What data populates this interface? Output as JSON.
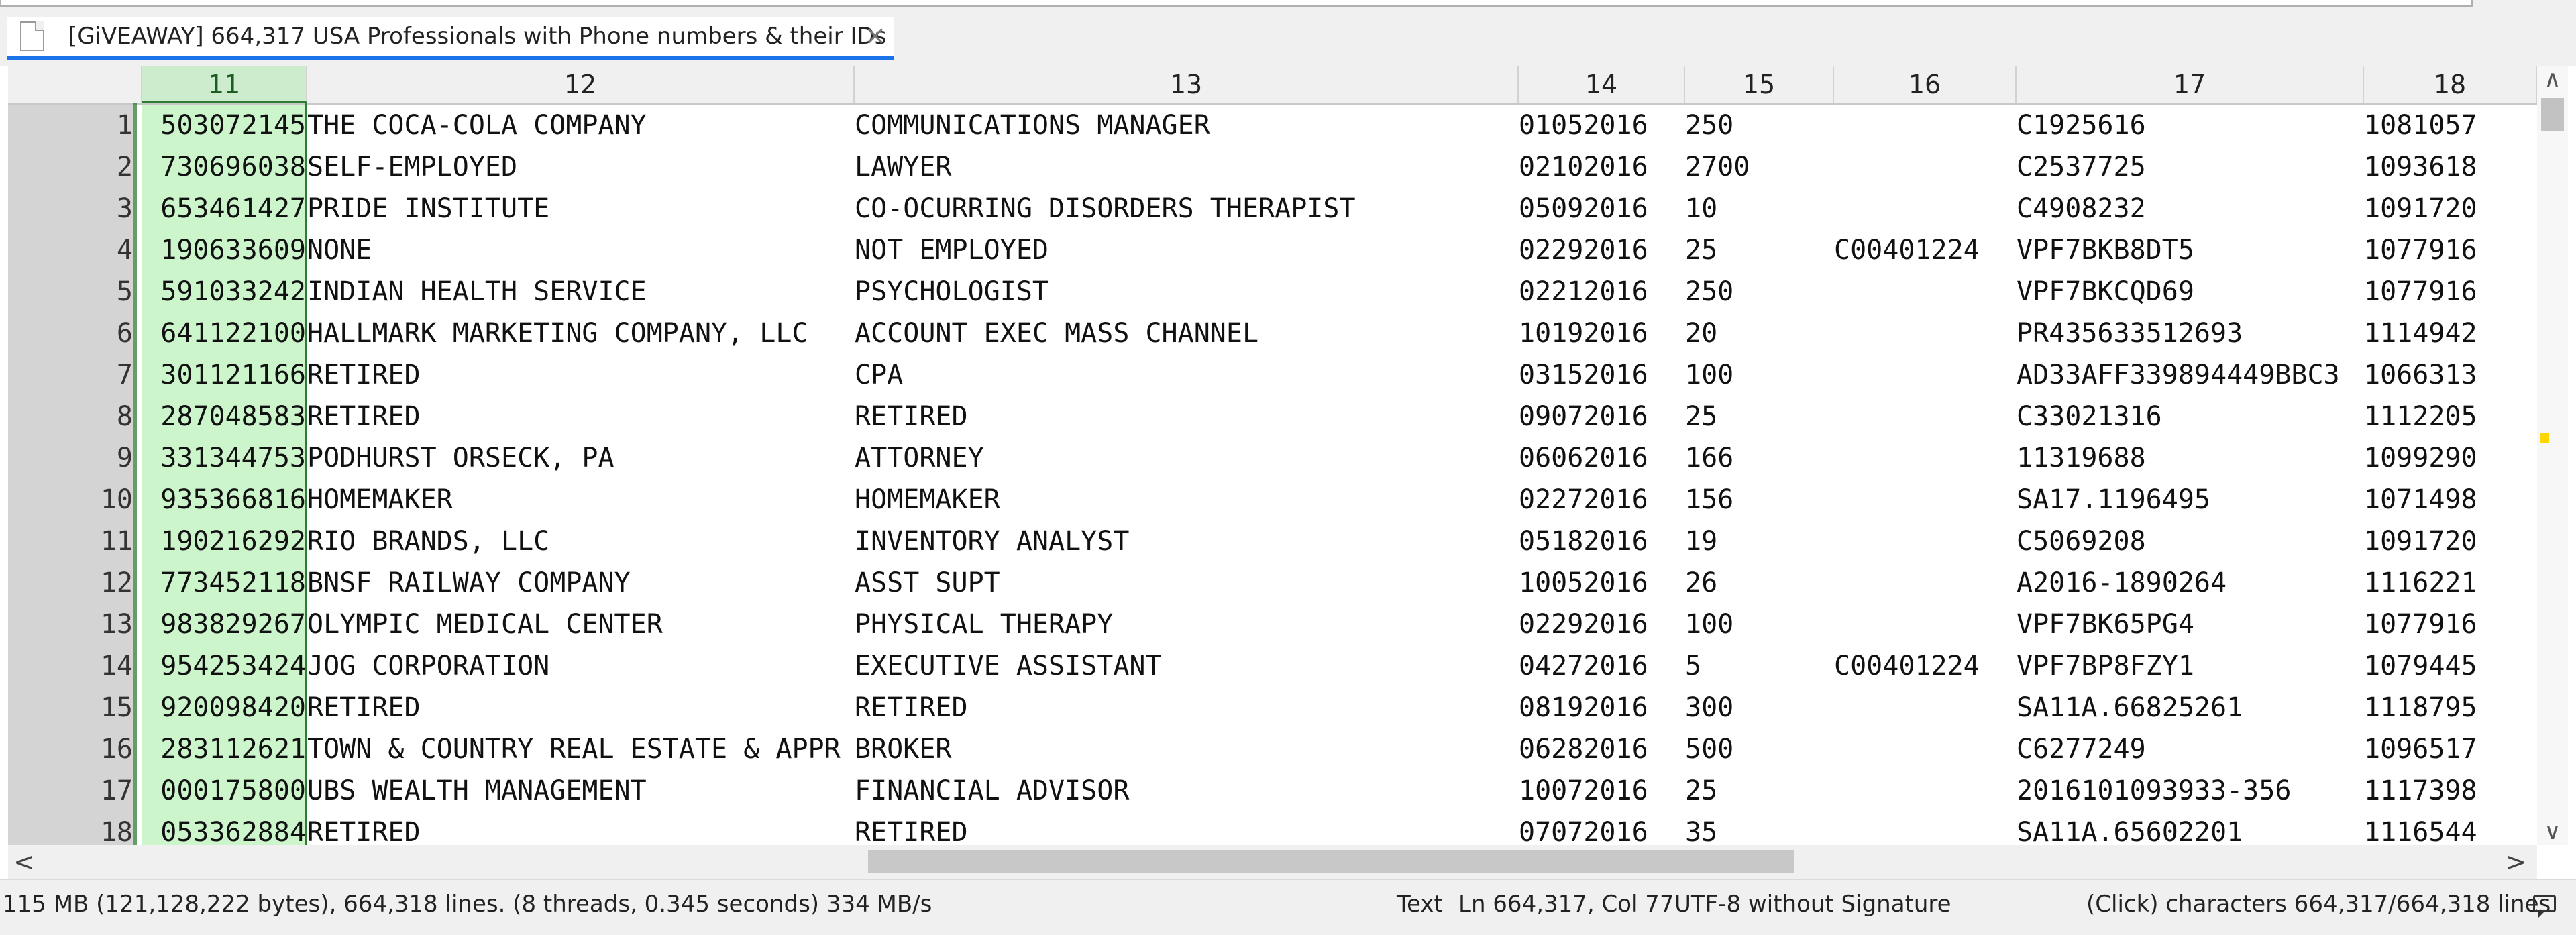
{
  "tab": {
    "title": "[GiVEAWAY] 664,317 USA Professionals with Phone numbers & their IDs",
    "close_glyph": "×",
    "doc_icon": "document-icon"
  },
  "grid": {
    "columns": [
      "11",
      "12",
      "13",
      "14",
      "15",
      "16",
      "17",
      "18"
    ],
    "selected_column": "11",
    "rows": [
      {
        "num": "1",
        "c11": "503072145",
        "c12": "THE COCA-COLA COMPANY",
        "c13": "COMMUNICATIONS MANAGER",
        "c14": "01052016",
        "c15": "250",
        "c16": "",
        "c17": "C1925616",
        "c18": "1081057"
      },
      {
        "num": "2",
        "c11": "730696038",
        "c12": "SELF-EMPLOYED",
        "c13": "LAWYER",
        "c14": "02102016",
        "c15": "2700",
        "c16": "",
        "c17": "C2537725",
        "c18": "1093618"
      },
      {
        "num": "3",
        "c11": "653461427",
        "c12": "PRIDE INSTITUTE",
        "c13": "CO-OCURRING DISORDERS THERAPIST",
        "c14": "05092016",
        "c15": "10",
        "c16": "",
        "c17": "C4908232",
        "c18": "1091720"
      },
      {
        "num": "4",
        "c11": "190633609",
        "c12": "NONE",
        "c13": "NOT EMPLOYED",
        "c14": "02292016",
        "c15": "25",
        "c16": "C00401224",
        "c17": "VPF7BKB8DT5",
        "c18": "1077916"
      },
      {
        "num": "5",
        "c11": "591033242",
        "c12": "INDIAN HEALTH SERVICE",
        "c13": "PSYCHOLOGIST",
        "c14": "02212016",
        "c15": "250",
        "c16": "",
        "c17": "VPF7BKCQD69",
        "c18": "1077916"
      },
      {
        "num": "6",
        "c11": "641122100",
        "c12": "HALLMARK MARKETING COMPANY, LLC",
        "c13": "ACCOUNT EXEC MASS CHANNEL",
        "c14": "10192016",
        "c15": "20",
        "c16": "",
        "c17": "PR435633512693",
        "c18": "1114942"
      },
      {
        "num": "7",
        "c11": "301121166",
        "c12": "RETIRED",
        "c13": "CPA",
        "c14": "03152016",
        "c15": "100",
        "c16": "",
        "c17": "AD33AFF339894449BBC3",
        "c18": "1066313"
      },
      {
        "num": "8",
        "c11": "287048583",
        "c12": "RETIRED",
        "c13": "RETIRED",
        "c14": "09072016",
        "c15": "25",
        "c16": "",
        "c17": "C33021316",
        "c18": "1112205"
      },
      {
        "num": "9",
        "c11": "331344753",
        "c12": "PODHURST ORSECK, PA",
        "c13": "ATTORNEY",
        "c14": "06062016",
        "c15": "166",
        "c16": "",
        "c17": "11319688",
        "c18": "1099290"
      },
      {
        "num": "10",
        "c11": "935366816",
        "c12": "HOMEMAKER",
        "c13": "HOMEMAKER",
        "c14": "02272016",
        "c15": "156",
        "c16": "",
        "c17": "SA17.1196495",
        "c18": "1071498"
      },
      {
        "num": "11",
        "c11": "190216292",
        "c12": "RIO BRANDS, LLC",
        "c13": "INVENTORY ANALYST",
        "c14": "05182016",
        "c15": "19",
        "c16": "",
        "c17": "C5069208",
        "c18": "1091720"
      },
      {
        "num": "12",
        "c11": "773452118",
        "c12": "BNSF RAILWAY COMPANY",
        "c13": "ASST SUPT",
        "c14": "10052016",
        "c15": "26",
        "c16": "",
        "c17": "A2016-1890264",
        "c18": "1116221"
      },
      {
        "num": "13",
        "c11": "983829267",
        "c12": "OLYMPIC MEDICAL CENTER",
        "c13": "PHYSICAL THERAPY",
        "c14": "02292016",
        "c15": "100",
        "c16": "",
        "c17": "VPF7BK65PG4",
        "c18": "1077916"
      },
      {
        "num": "14",
        "c11": "954253424",
        "c12": "JOG CORPORATION",
        "c13": "EXECUTIVE ASSISTANT",
        "c14": "04272016",
        "c15": "5",
        "c16": "C00401224",
        "c17": "VPF7BP8FZY1",
        "c18": "1079445"
      },
      {
        "num": "15",
        "c11": "920098420",
        "c12": "RETIRED",
        "c13": "RETIRED",
        "c14": "08192016",
        "c15": "300",
        "c16": "",
        "c17": "SA11A.66825261",
        "c18": "1118795"
      },
      {
        "num": "16",
        "c11": "283112621",
        "c12": "TOWN & COUNTRY REAL ESTATE & APPR",
        "c13": "BROKER",
        "c14": "06282016",
        "c15": "500",
        "c16": "",
        "c17": "C6277249",
        "c18": "1096517"
      },
      {
        "num": "17",
        "c11": "000175800",
        "c12": "UBS WEALTH MANAGEMENT",
        "c13": "FINANCIAL ADVISOR",
        "c14": "10072016",
        "c15": "25",
        "c16": "",
        "c17": "2016101093933-356",
        "c18": "1117398"
      },
      {
        "num": "18",
        "c11": "053362884",
        "c12": "RETIRED",
        "c13": "RETIRED",
        "c14": "07072016",
        "c15": "35",
        "c16": "",
        "c17": "SA11A.65602201",
        "c18": "1116544"
      }
    ]
  },
  "scrollbars": {
    "up": "∧",
    "down": "∨",
    "left": "<",
    "right": ">"
  },
  "status": {
    "file_info": "115 MB (121,128,222 bytes), 664,318 lines. (8 threads, 0.345 seconds) 334 MB/s",
    "mode": "Text",
    "position": "Ln 664,317, Col 77",
    "encoding": "UTF-8 without Signature",
    "count": "(Click) characters  664,317/664,318 lines",
    "chat_icon": "chat-icon"
  },
  "colors": {
    "accent": "#1a73e8",
    "selected_column_bg": "#ccf5cc",
    "selected_column_line": "#2e7d32",
    "gutter": "#d4d4d4"
  }
}
